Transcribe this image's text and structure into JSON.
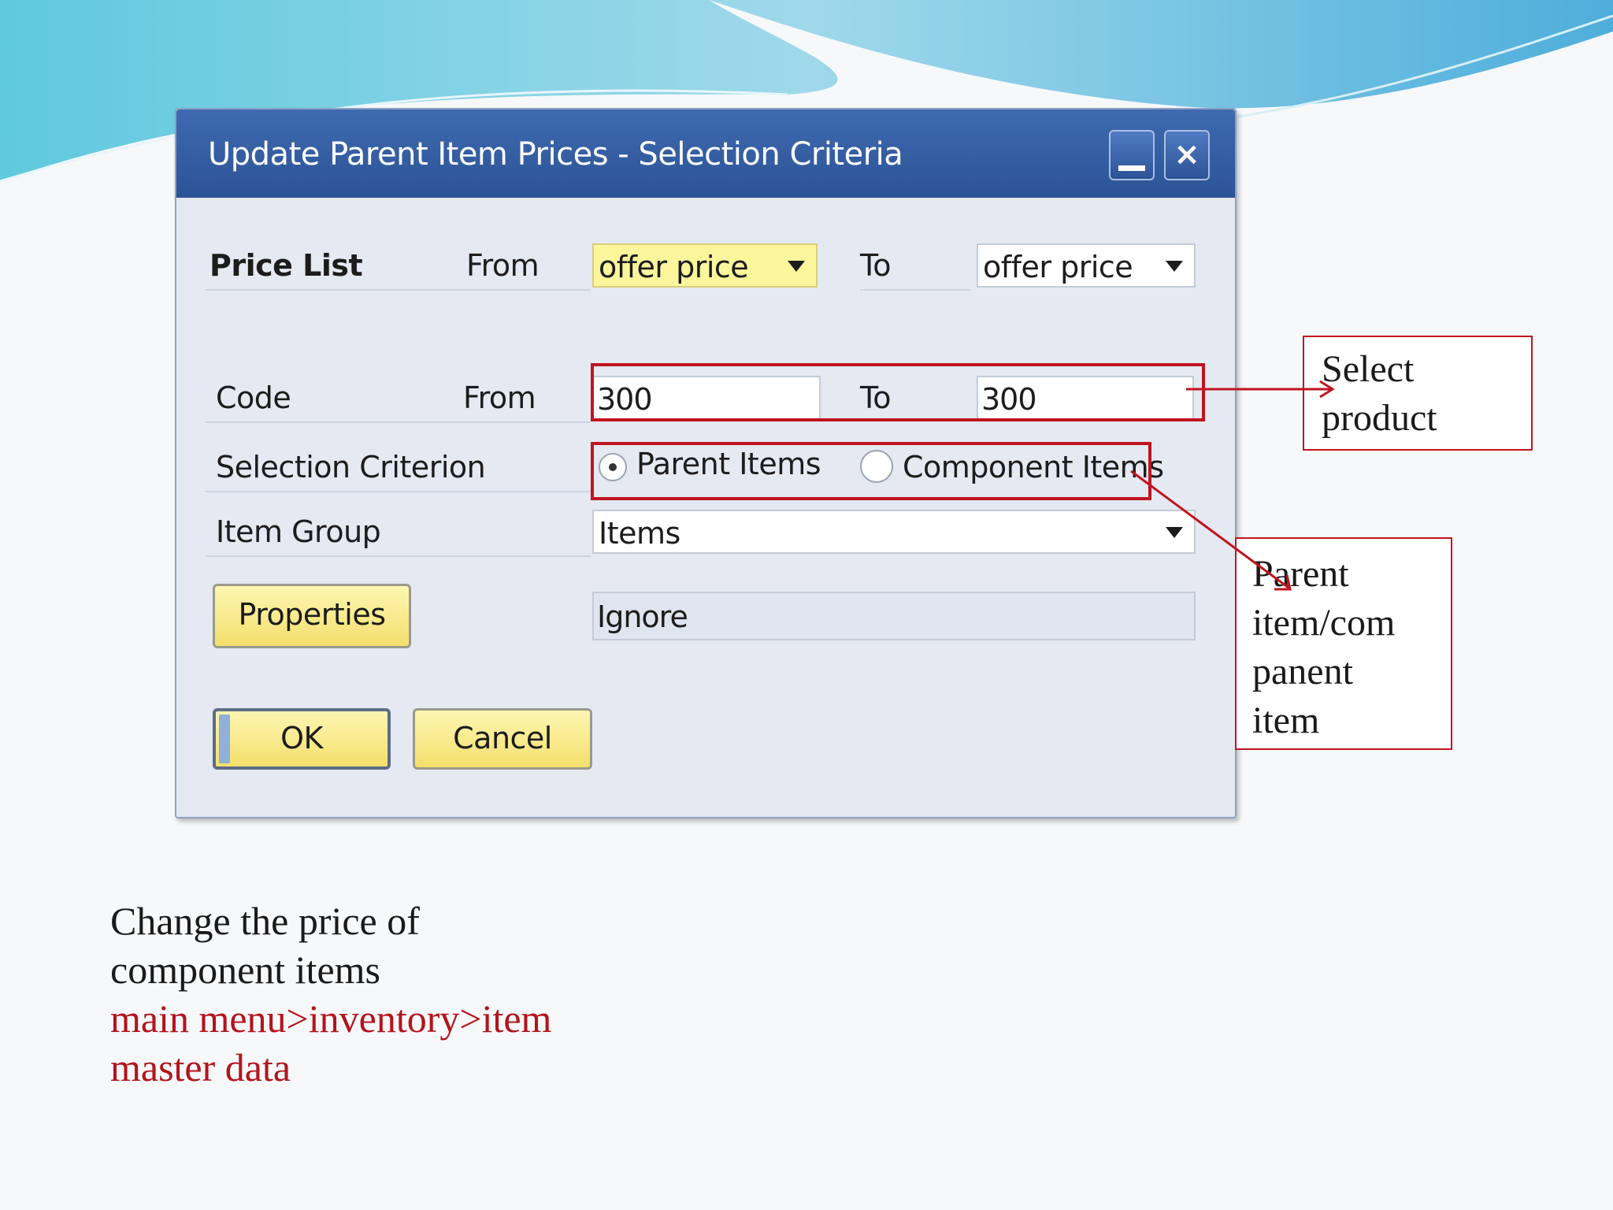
{
  "dialog": {
    "title": "Update Parent Item Prices - Selection Criteria",
    "price_list": {
      "label": "Price List",
      "from_label": "From",
      "from_value": "offer price",
      "to_label": "To",
      "to_value": "offer price"
    },
    "code": {
      "label": "Code",
      "from_label": "From",
      "from_value": "300",
      "to_label": "To",
      "to_value": "300"
    },
    "selection_criterion": {
      "label": "Selection Criterion",
      "options": [
        "Parent Items",
        "Component Items"
      ],
      "selected": "Parent Items"
    },
    "item_group": {
      "label": "Item Group",
      "value": "Items"
    },
    "properties_button": "Properties",
    "properties_value": "Ignore",
    "ok_button": "OK",
    "cancel_button": "Cancel"
  },
  "annotations": {
    "select_product": [
      "Select",
      "product"
    ],
    "parent_component": [
      "Parent",
      "item/com",
      "panent",
      "item"
    ]
  },
  "caption": {
    "lines": [
      "Change the price of",
      "component items"
    ],
    "red_lines": [
      "main menu>inventory>item",
      "master data"
    ]
  },
  "colors": {
    "title_bar": "#2c5396",
    "highlight": "#c0151f",
    "button_yellow": "#f4df6c",
    "caption_red": "#b3141c"
  },
  "icons": {
    "minimize": "minimize-icon",
    "close": "close-icon",
    "dropdown": "chevron-down-icon"
  }
}
